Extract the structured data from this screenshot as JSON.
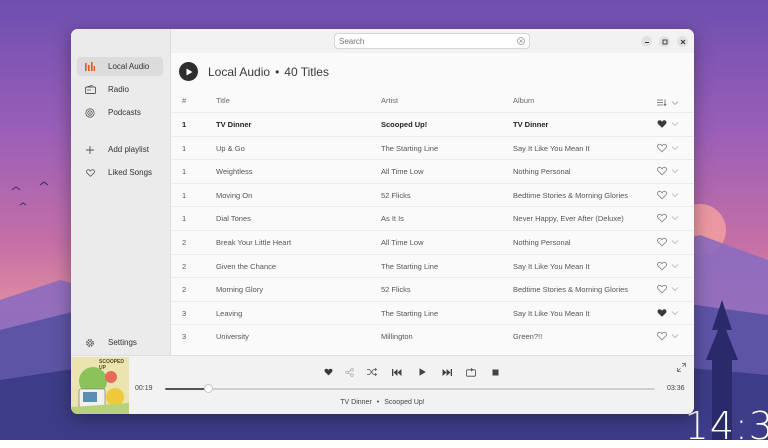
{
  "search": {
    "placeholder": "Search",
    "value": ""
  },
  "sidebar": {
    "items": [
      {
        "label": "Local Audio",
        "icon": "audio-bars-icon",
        "active": true
      },
      {
        "label": "Radio",
        "icon": "radio-icon"
      },
      {
        "label": "Podcasts",
        "icon": "podcast-icon"
      },
      {
        "label": "Add playlist",
        "icon": "plus-icon"
      },
      {
        "label": "Liked Songs",
        "icon": "heart-icon"
      }
    ],
    "settings_label": "Settings"
  },
  "main": {
    "section_title": "Local Audio",
    "dot": "•",
    "count_label": "40 Titles",
    "columns": {
      "num": "#",
      "title": "Title",
      "artist": "Artist",
      "album": "Album"
    },
    "tracks": [
      {
        "num": "1",
        "title": "TV Dinner",
        "artist": "Scooped Up!",
        "album": "TV Dinner",
        "liked": true,
        "playing": true
      },
      {
        "num": "1",
        "title": "Up & Go",
        "artist": "The Starting Line",
        "album": "Say It Like You Mean It",
        "liked": false
      },
      {
        "num": "1",
        "title": "Weightless",
        "artist": "All Time Low",
        "album": "Nothing Personal",
        "liked": false
      },
      {
        "num": "1",
        "title": "Moving On",
        "artist": "52 Flicks",
        "album": "Bedtime Stories & Morning Glories",
        "liked": false
      },
      {
        "num": "1",
        "title": "Dial Tones",
        "artist": "As It Is",
        "album": "Never Happy, Ever After (Deluxe)",
        "liked": false
      },
      {
        "num": "2",
        "title": "Break Your Little Heart",
        "artist": "All Time Low",
        "album": "Nothing Personal",
        "liked": false
      },
      {
        "num": "2",
        "title": "Given the Chance",
        "artist": "The Starting Line",
        "album": "Say It Like You Mean It",
        "liked": false
      },
      {
        "num": "2",
        "title": "Morning Glory",
        "artist": "52 Flicks",
        "album": "Bedtime Stories & Morning Glories",
        "liked": false
      },
      {
        "num": "3",
        "title": "Leaving",
        "artist": "The Starting Line",
        "album": "Say It Like You Mean It",
        "liked": true
      },
      {
        "num": "3",
        "title": "University",
        "artist": "Millington",
        "album": "Green?!!",
        "liked": false
      }
    ]
  },
  "player": {
    "elapsed": "00:19",
    "duration": "03:36",
    "progress_fraction": 0.088,
    "now_title": "TV Dinner",
    "now_sep": "•",
    "now_artist": "Scooped Up!",
    "cover_text": "SCOOPED UP"
  },
  "desktop": {
    "clock": "14:3"
  },
  "colors": {
    "accent": "#e95420",
    "heart_filled": "#3a3a3a"
  }
}
